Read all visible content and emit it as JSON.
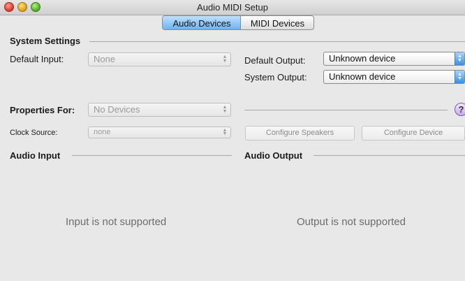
{
  "window": {
    "title": "Audio MIDI Setup"
  },
  "tabs": [
    {
      "label": "Audio Devices",
      "active": true
    },
    {
      "label": "MIDI Devices",
      "active": false
    }
  ],
  "system_settings": {
    "title": "System Settings",
    "default_input_label": "Default Input:",
    "default_input_value": "None",
    "default_output_label": "Default Output:",
    "default_output_value": "Unknown device",
    "system_output_label": "System Output:",
    "system_output_value": "Unknown device"
  },
  "properties": {
    "label": "Properties For:",
    "value": "No Devices",
    "clock_source_label": "Clock Source:",
    "clock_source_value": "none",
    "configure_speakers_label": "Configure Speakers",
    "configure_device_label": "Configure Device",
    "help_label": "?"
  },
  "audio_input": {
    "title": "Audio Input",
    "message": "Input is not supported"
  },
  "audio_output": {
    "title": "Audio Output",
    "message": "Output is not supported"
  },
  "icons": {
    "popup_arrows": "▲▼"
  }
}
